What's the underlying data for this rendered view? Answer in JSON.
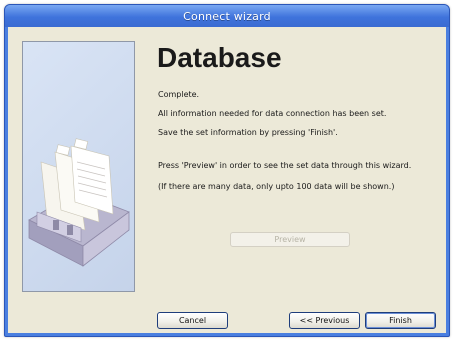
{
  "window": {
    "title": "Connect wizard"
  },
  "page": {
    "heading": "Database",
    "messages": [
      "Complete.",
      "All information needed for data connection has been set.",
      "Save the set information by pressing 'Finish'.",
      "Press 'Preview' in order to see the set data through this wizard.",
      "(If there are many data, only upto 100 data will be shown.)"
    ]
  },
  "buttons": {
    "preview": "Preview",
    "cancel": "Cancel",
    "previous": "<< Previous",
    "finish": "Finish"
  },
  "state": {
    "preview_enabled": false
  },
  "theme": {
    "titlebar_color": "#3f73dc",
    "dialog_background": "#ece9d8",
    "panel_background": "#d9e4f5"
  },
  "icons": {
    "wizard_illustration": "card-file-icon"
  }
}
